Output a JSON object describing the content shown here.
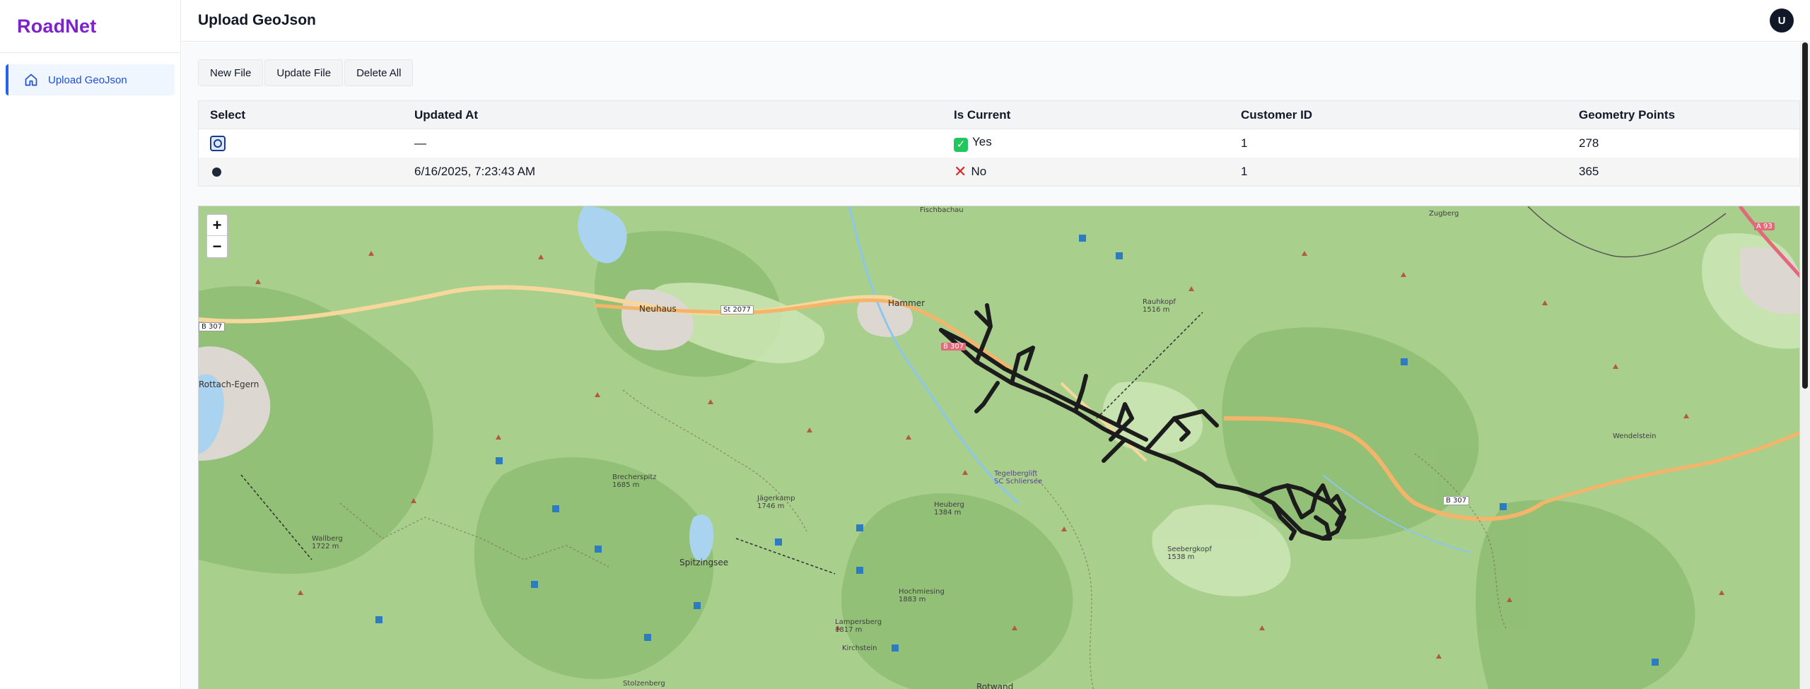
{
  "brand": {
    "name": "RoadNet",
    "color": "#7e22ce"
  },
  "sidebar": {
    "items": [
      {
        "label": "Upload GeoJson",
        "icon": "home-icon",
        "active": true
      }
    ]
  },
  "header": {
    "title": "Upload GeoJson",
    "avatar_initial": "U"
  },
  "toolbar": {
    "new_label": "New File",
    "update_label": "Update File",
    "delete_label": "Delete All"
  },
  "table": {
    "columns": [
      "Select",
      "Updated At",
      "Is Current",
      "Customer ID",
      "Geometry Points"
    ],
    "rows": [
      {
        "selected": true,
        "updated_at": "—",
        "is_current": "Yes",
        "customer_id": "1",
        "geometry_points": "278"
      },
      {
        "selected": false,
        "updated_at": "6/16/2025, 7:23:43 AM",
        "is_current": "No",
        "customer_id": "1",
        "geometry_points": "365"
      }
    ]
  },
  "map": {
    "zoom_in": "+",
    "zoom_out": "−",
    "labels": {
      "neuhaus": "Neuhaus",
      "hammer": "Hammer",
      "spitzingsee": "Spitzingsee",
      "rottach": "Rottach-Egern",
      "st2077": "St 2077",
      "b307a": "B 307",
      "b307b": "B 307",
      "b307c": "B 307",
      "a93": "A 93",
      "fischbachau": "Fischbachau",
      "wallberg": "Wallberg\n1722 m",
      "brecherspitz": "Brecherspitz\n1685 m",
      "jagerkamp": "Jägerkamp\n1746 m",
      "heuberg": "Heuberg\n1384 m",
      "seebergkopf": "Seebergkopf\n1538 m",
      "rotwand": "Rotwand",
      "kirchstein": "Kirchstein",
      "lampersberg": "Lampersberg\n1817 m",
      "tegelberg": "Tegelberglift\nSC Schliersee",
      "hochmiesing": "Hochmiesing\n1883 m",
      "stolzenberg": "Stolzenberg",
      "rauhkopf": "Rauhkopf\n1516 m",
      "zugberg": "Zugberg",
      "wendelstein": "Wendelstein"
    }
  }
}
